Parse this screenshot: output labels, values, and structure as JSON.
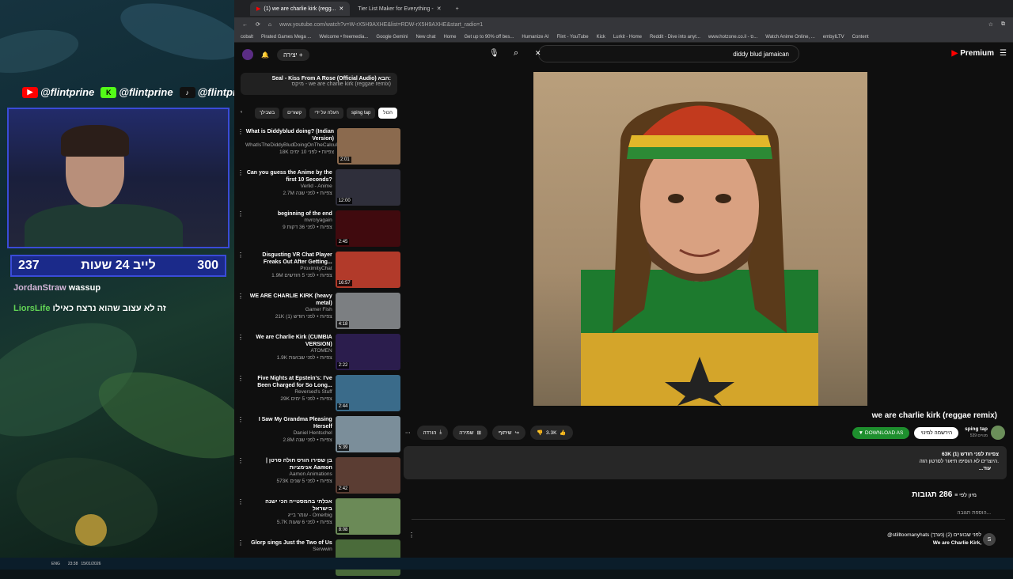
{
  "stream": {
    "socials": [
      "@flintprine",
      "@flintprine",
      "@flintprine"
    ],
    "goal": {
      "left": "237",
      "center": "לייב 24 שעות",
      "right": "300"
    },
    "chat": [
      {
        "user": "JordanStraw",
        "msg": "wassup"
      },
      {
        "user": "LiorsLife",
        "msg": "זה לא עצוב שהוא נרצח כאילו"
      }
    ]
  },
  "browser": {
    "tabs": [
      "(1) we are charlie kirk (regg...",
      "Tier List Maker for Everything -"
    ],
    "url": "www.youtube.com/watch?v=W-rX5H9AXHE&list=RDW-rX5H9AXHE&start_radio=1",
    "bookmarks": [
      "cobalt",
      "Pirated Games Mega ...",
      "Welcome • freemedia...",
      "Google Gemini",
      "New chat",
      "Home",
      "Get up to 90% off bes...",
      "Humanize AI",
      "Flint - YouTube",
      "Kick",
      "Lurkit - Home",
      "Reddit - Dive into anyt...",
      "www.hotzone.co.il - ס...",
      "Watch Anime Online, ...",
      "embyILTV",
      "Content"
    ]
  },
  "yt": {
    "search": "diddy blud jamaican",
    "premium": "Premium",
    "create": "יצירה",
    "playlist": {
      "title": "Seal - Kiss From A Rose (Official Audio) הבא:",
      "sub": "מיקס - we are charlie kirk (reggae remix)"
    },
    "chips": [
      "הכול",
      "sping tap",
      "העלה על ידי",
      "קשורים",
      "בשבילך"
    ],
    "recs": [
      {
        "title": "What is Diddyblud doing? (Indian Version)",
        "ch": "WhatIsTheDiddyBludDoingOnTheCalcul...",
        "meta": "18K צפיות • לפני 10 ימים",
        "dur": "2:01",
        "bg": "#8b6a4e"
      },
      {
        "title": "Can you guess the Anime by the first 10 Seconds?",
        "ch": "Verlid - Anime",
        "meta": "2.7M צפיות • לפני שנה",
        "dur": "12:00",
        "bg": "#2f2f3b"
      },
      {
        "title": "beginning of the end",
        "ch": "mvrcryagain",
        "meta": "9 צפיות • לפני 36 דקות",
        "dur": "2:45",
        "bg": "#400a0e"
      },
      {
        "title": "Disgusting VR Chat Player Freaks Out After Getting...",
        "ch": "ProximityChat",
        "meta": "1.9M צפיות • לפני 5 חודשים",
        "dur": "16:57",
        "bg": "#b23a2a"
      },
      {
        "title": "WE ARE CHARLIE KIRK (heavy metal)",
        "ch": "Gamer Fish",
        "meta": "21K צפיות • לפני חודש (1)",
        "dur": "4:18",
        "bg": "#7c7f82"
      },
      {
        "title": "We are Charlie Kirk (CUMBIA VERSION)",
        "ch": "ATOMEN",
        "meta": "1.9K צפיות • לפני שבועות",
        "dur": "2:22",
        "bg": "#2b1d4d"
      },
      {
        "title": "Five Nights at Epstein's: I've Been Charged for So Long...",
        "ch": "Reversed's Stuff",
        "meta": "29K צפיות • לפני 5 ימים",
        "dur": "2:44",
        "bg": "#3a6b8a"
      },
      {
        "title": "I Saw My Grandma Pleasing Herself",
        "ch": "Daniel Hentschel",
        "meta": "2.8M צפיות • לפני שנה",
        "dur": "5:39",
        "bg": "#7b8e9a"
      },
      {
        "title": "בן שפירו הורס חולה סרטן | אנימציות Aamon",
        "ch": "Aamon Animations",
        "meta": "573K צפיות • לפני 5 שנים",
        "dur": "2:42",
        "bg": "#5b3d33"
      },
      {
        "title": "אכלתי בחמסטייה הכי ישנה בישראל",
        "ch": "עומר בייג - Omerbig",
        "meta": "5.7K צפיות • לפני 6 שעות",
        "dur": "8:08",
        "bg": "#6b8a57"
      },
      {
        "title": "Glorp sings Just the Two of Us",
        "ch": "Serwwin",
        "meta": "",
        "dur": "",
        "bg": "#4a6b3a"
      }
    ],
    "video": {
      "title": "we are charlie kirk (reggae remix)",
      "channel": "sping tap",
      "subs": "539 מנויים",
      "subscribe": "הירשמה למינוי",
      "download": "DOWNLOAD AS",
      "likes": "3.3K",
      "share": "שיתוף",
      "save": "שמירה",
      "dl": "הורדה"
    },
    "desc": {
      "line1": "63K צפיות לפני חודש (1)",
      "line2": "היוצרים לא הוסיפו תיאור לסרטון הזה.",
      "more": "...עוד"
    },
    "comments": {
      "count": "286 תגובות",
      "sort": "מיון לפי",
      "add": "הוספת תגובה...",
      "first_user": "@stilltoomanyhats לפני שבועיים (2) (נערך)",
      "first_text": "We are Charlie Kirk,"
    }
  },
  "taskbar": {
    "lang": "ENG",
    "time": "23:38",
    "date": "15/01/2026"
  }
}
